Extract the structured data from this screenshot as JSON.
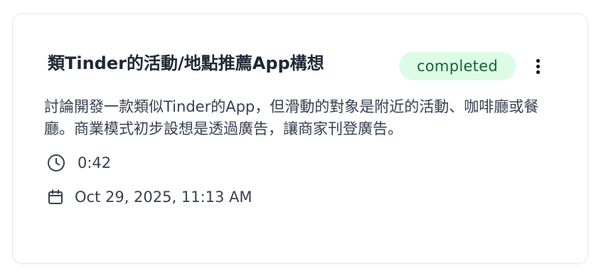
{
  "card": {
    "title": "類Tinder的活動/地點推薦App構想",
    "status": "completed",
    "description": "討論開發一款類似Tinder的App，但滑動的對象是附近的活動、咖啡廳或餐廳。商業模式初步設想是透過廣告，讓商家刊登廣告。",
    "duration": "0:42",
    "date": "Oct 29, 2025, 11:13 AM",
    "icons": {
      "menu": "more-vertical-icon",
      "duration": "clock-icon",
      "date": "calendar-icon"
    },
    "colors": {
      "badge_bg": "#dcfce7",
      "badge_text": "#166534",
      "title": "#1f2937",
      "text": "#374151"
    }
  }
}
